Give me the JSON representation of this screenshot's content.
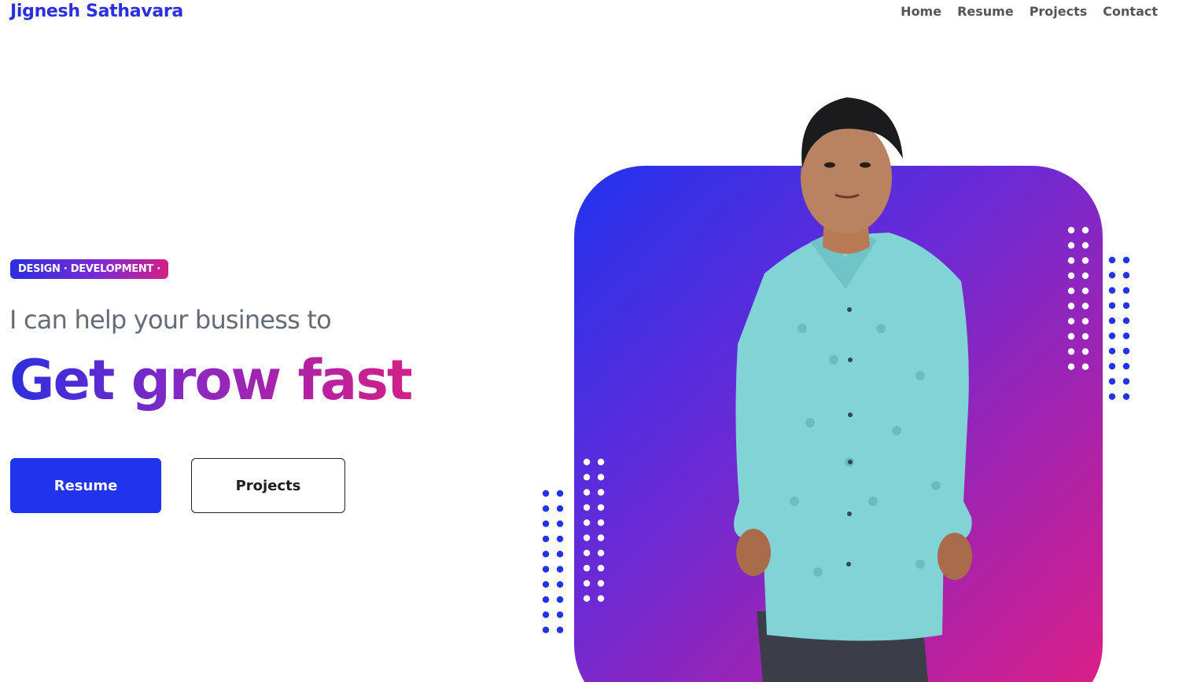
{
  "header": {
    "brand": "Jignesh Sathavara",
    "nav": [
      "Home",
      "Resume",
      "Projects",
      "Contact"
    ]
  },
  "hero": {
    "tag": "DESIGN · DEVELOPMENT ·",
    "subline": "I can help your business to",
    "headline": "Get grow fast",
    "buttons": {
      "resume": "Resume",
      "projects": "Projects"
    }
  },
  "colors": {
    "brand": "#2b2fe0",
    "accent_pink": "#e01e84",
    "accent_blue": "#2233ee",
    "shirt": "#7fd3d6"
  }
}
